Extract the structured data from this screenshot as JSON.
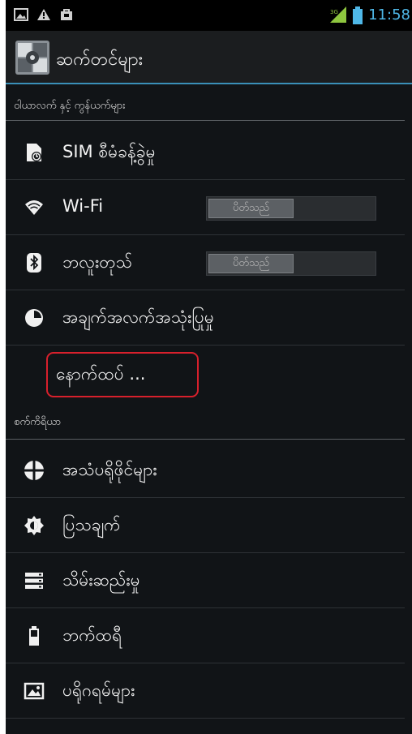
{
  "status_bar": {
    "icons": [
      "image-icon",
      "warning-icon",
      "bag-icon"
    ],
    "signal": "signal-icon",
    "battery": "battery-icon",
    "time": "11:58"
  },
  "action_bar": {
    "icon": "settings-app-icon",
    "title": "ဆက်တင်များ"
  },
  "sections": {
    "wireless_header": "ဝါယာလက် နှင့် ကွန်ယက်များ",
    "device_header": "စက်ကိရိယာ"
  },
  "wireless_items": {
    "sim": "SIM စီမံခန့်ခွဲမှု",
    "wifi": "Wi-Fi",
    "wifi_toggle": "ပိတ်သည်",
    "bluetooth": "ဘလူးတုသ်",
    "bluetooth_toggle": "ပိတ်သည်",
    "data_usage": "အချက်အလက်အသုံးပြုမှု",
    "more": "နောက်ထပ် ..."
  },
  "device_items": {
    "sound": "အသံပရိုဖိုင်များ",
    "display": "ပြသချက်",
    "storage": "သိမ်းဆည်းမှု",
    "battery": "ဘက်ထရီ",
    "apps": "ပရိုဂရမ်များ"
  },
  "colors": {
    "accent": "#3a90b8",
    "highlight": "#d8202c",
    "time": "#4fb8e8",
    "signal": "#8ec63f"
  }
}
